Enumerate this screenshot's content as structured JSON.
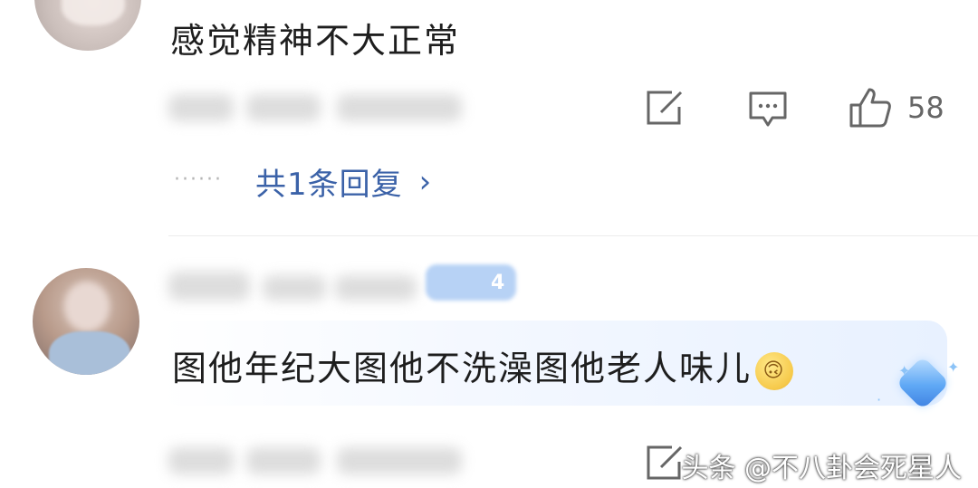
{
  "comments": [
    {
      "text": "感觉精神不大正常",
      "like_count": "58",
      "reply_dots": "······",
      "reply_link": "共1条回复",
      "reply_chevron": "›"
    },
    {
      "badge_text": "4",
      "text": "图他年纪大图他不洗澡图他老人味儿",
      "emoji": "🙃"
    }
  ],
  "icons": {
    "share": "share-icon",
    "comment": "comment-icon",
    "like": "thumbs-up-icon"
  },
  "watermark": "头条 @不八卦会死星人",
  "colors": {
    "link": "#3b62a8",
    "icon": "#666666",
    "bubble": "#e8f1ff"
  }
}
